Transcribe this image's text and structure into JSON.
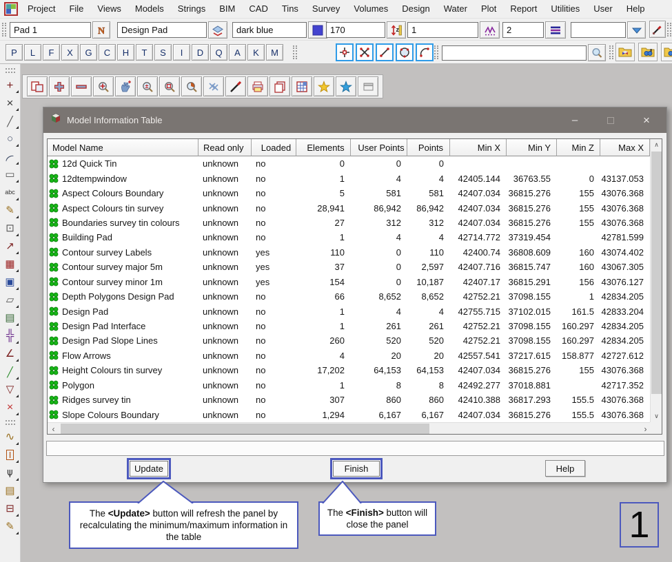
{
  "icons": {
    "scroll_up": "∧",
    "scroll_down": "∨",
    "scroll_left": "‹",
    "scroll_right": "›",
    "minimize": "–",
    "close": "×"
  },
  "menu": {
    "items": [
      "Project",
      "File",
      "Views",
      "Models",
      "Strings",
      "BIM",
      "CAD",
      "Tins",
      "Survey",
      "Volumes",
      "Design",
      "Water",
      "Plot",
      "Report",
      "Utilities",
      "User",
      "Help"
    ]
  },
  "toolbar1": {
    "fields": [
      {
        "name": "cad-text-field",
        "value": "Pad 1",
        "icon": "n-icon"
      },
      {
        "name": "model-field",
        "value": "Design Pad",
        "icon": "layers-icon"
      },
      {
        "name": "colour-field",
        "value": "dark blue",
        "icon": "swatch-icon"
      },
      {
        "name": "height-field",
        "value": "170",
        "icon": "zruler-icon"
      },
      {
        "name": "weight-field",
        "value": "1",
        "icon": "zigzag-icon"
      },
      {
        "name": "linestyle-field",
        "value": "2",
        "icon": "lines-icon"
      },
      {
        "name": "tinable-field",
        "value": "",
        "icon": "dropdown-icon"
      }
    ]
  },
  "toolbar2": {
    "letters": [
      "P",
      "L",
      "F",
      "X",
      "G",
      "C",
      "H",
      "T",
      "S",
      "I",
      "D",
      "Q",
      "A",
      "K",
      "M"
    ],
    "snaps": [
      {
        "name": "snap-point",
        "icon": "snap-point"
      },
      {
        "name": "snap-cross",
        "icon": "snap-cross"
      },
      {
        "name": "snap-line",
        "icon": "snap-line"
      },
      {
        "name": "snap-circle",
        "icon": "snap-circle"
      },
      {
        "name": "snap-arc",
        "icon": "snap-arc"
      }
    ],
    "search_value": "",
    "folders": [
      {
        "name": "models-folder-button",
        "icon": "folder-cube"
      },
      {
        "name": "settings-folder-button",
        "icon": "folder-gears"
      },
      {
        "name": "extra-folder-button",
        "icon": "folder-plain"
      }
    ]
  },
  "floatbar": {
    "buttons": [
      {
        "name": "tile-views-button",
        "icon": "ft-panel"
      },
      {
        "name": "add-view-button",
        "icon": "ft-plus"
      },
      {
        "name": "remove-view-button",
        "icon": "ft-minus"
      },
      {
        "name": "zoom-extents-button",
        "icon": "ft-zoomext"
      },
      {
        "name": "pan-button",
        "icon": "ft-pan"
      },
      {
        "name": "zoom-inout-button",
        "icon": "ft-zoompm"
      },
      {
        "name": "zoom-fit-button",
        "icon": "ft-zoomfit"
      },
      {
        "name": "zoom-previous-button",
        "icon": "ft-zoomprev"
      },
      {
        "name": "no-regen-button",
        "icon": "ft-noregen"
      },
      {
        "name": "regen-brush-button",
        "icon": "ft-brush"
      },
      {
        "name": "plot-button",
        "icon": "ft-print"
      },
      {
        "name": "copy-view-button",
        "icon": "ft-copy"
      },
      {
        "name": "sheet-grid-button",
        "icon": "ft-grid"
      },
      {
        "name": "favourite-yellow-button",
        "icon": "ft-star-y"
      },
      {
        "name": "favourite-blue-button",
        "icon": "ft-star-b"
      },
      {
        "name": "panel-extra-button",
        "icon": "ft-panel2"
      }
    ]
  },
  "sidebar": {
    "tools": [
      {
        "type": "grip"
      },
      {
        "name": "create-point-tool",
        "glyph": "+",
        "color": "#7a1f1f",
        "size": 17
      },
      {
        "name": "junction-cross-tool",
        "glyph": "×",
        "color": "#3a3a3a",
        "size": 17
      },
      {
        "name": "create-line-tool",
        "glyph": "╱",
        "color": "#555",
        "size": 14
      },
      {
        "name": "create-circle-tool",
        "glyph": "○",
        "color": "#44506a",
        "size": 15
      },
      {
        "name": "create-arc-tool",
        "glyph": "(",
        "color": "#44506a",
        "size": 14,
        "rot": 55
      },
      {
        "name": "create-rectangle-tool",
        "glyph": "▭",
        "color": "#555",
        "size": 15
      },
      {
        "name": "create-text-tool",
        "glyph": "abc",
        "color": "#333",
        "size": 9
      },
      {
        "name": "edit-pencil-tool",
        "glyph": "✎",
        "color": "#9a7020",
        "size": 15
      },
      {
        "name": "point-symbol-tool",
        "glyph": "⊡",
        "color": "#555",
        "size": 15
      },
      {
        "name": "measure-tool",
        "glyph": "↗",
        "color": "#7a1f1f",
        "size": 15
      },
      {
        "name": "grid-tool",
        "glyph": "▦",
        "color": "#9a2020",
        "size": 15
      },
      {
        "name": "view-windows-tool",
        "glyph": "▣",
        "color": "#2a4a9a",
        "size": 15
      },
      {
        "name": "clip-polygon-tool",
        "glyph": "▱",
        "color": "#555",
        "size": 15
      },
      {
        "name": "image-tool",
        "glyph": "▤",
        "color": "#3a6a3a",
        "size": 15
      },
      {
        "name": "translate-tool",
        "glyph": "╬",
        "color": "#6a2a8a",
        "size": 16
      },
      {
        "name": "angle-tool",
        "glyph": "∠",
        "color": "#7a1f1f",
        "size": 15
      },
      {
        "name": "segment-colours-tool",
        "glyph": "╱",
        "color": "#2a8a2a",
        "size": 14
      },
      {
        "name": "polygon-tool",
        "glyph": "▽",
        "color": "#7a1f1f",
        "size": 15
      },
      {
        "name": "delete-points-tool",
        "glyph": "×",
        "color": "#c03030",
        "size": 16
      },
      {
        "type": "grip"
      },
      {
        "name": "freehand-draw-tool",
        "glyph": "∿",
        "color": "#9a7020",
        "size": 16
      },
      {
        "name": "interface-tool",
        "glyph": "I",
        "color": "#b05010",
        "size": 13,
        "boxed": true
      },
      {
        "name": "survey-instrument-tool",
        "glyph": "⋔",
        "color": "#333",
        "size": 15,
        "rot": 180
      },
      {
        "name": "edit-notes-tool",
        "glyph": "▤",
        "color": "#9a7020",
        "size": 15
      },
      {
        "name": "section-tool",
        "glyph": "⊟",
        "color": "#7a1f1f",
        "size": 15
      },
      {
        "name": "sketch-tool",
        "glyph": "✎",
        "color": "#9a7020",
        "size": 15
      }
    ]
  },
  "dialog": {
    "title": "Model Information Table",
    "table": {
      "columns": [
        {
          "key": "name",
          "label": "Model Name"
        },
        {
          "key": "read_only",
          "label": "Read only"
        },
        {
          "key": "loaded",
          "label": "Loaded"
        },
        {
          "key": "elements",
          "label": "Elements"
        },
        {
          "key": "user_points",
          "label": "User Points"
        },
        {
          "key": "points",
          "label": "Points"
        },
        {
          "key": "min_x",
          "label": "Min X"
        },
        {
          "key": "min_y",
          "label": "Min Y"
        },
        {
          "key": "min_z",
          "label": "Min Z"
        },
        {
          "key": "max_x",
          "label": "Max X"
        }
      ],
      "rows": [
        {
          "name": "12d Quick Tin",
          "read_only": "unknown",
          "loaded": "no",
          "elements": "0",
          "user_points": "0",
          "points": "0",
          "min_x": "",
          "min_y": "",
          "min_z": "",
          "max_x": ""
        },
        {
          "name": "12dtempwindow",
          "read_only": "unknown",
          "loaded": "no",
          "elements": "1",
          "user_points": "4",
          "points": "4",
          "min_x": "42405.144",
          "min_y": "36763.55",
          "min_z": "0",
          "max_x": "43137.053"
        },
        {
          "name": "Aspect Colours Boundary",
          "read_only": "unknown",
          "loaded": "no",
          "elements": "5",
          "user_points": "581",
          "points": "581",
          "min_x": "42407.034",
          "min_y": "36815.276",
          "min_z": "155",
          "max_x": "43076.368"
        },
        {
          "name": "Aspect Colours tin survey",
          "read_only": "unknown",
          "loaded": "no",
          "elements": "28,941",
          "user_points": "86,942",
          "points": "86,942",
          "min_x": "42407.034",
          "min_y": "36815.276",
          "min_z": "155",
          "max_x": "43076.368"
        },
        {
          "name": "Boundaries survey tin colours",
          "read_only": "unknown",
          "loaded": "no",
          "elements": "27",
          "user_points": "312",
          "points": "312",
          "min_x": "42407.034",
          "min_y": "36815.276",
          "min_z": "155",
          "max_x": "43076.368"
        },
        {
          "name": "Building Pad",
          "read_only": "unknown",
          "loaded": "no",
          "elements": "1",
          "user_points": "4",
          "points": "4",
          "min_x": "42714.772",
          "min_y": "37319.454",
          "min_z": "",
          "max_x": "42781.599"
        },
        {
          "name": "Contour survey Labels",
          "read_only": "unknown",
          "loaded": "yes",
          "elements": "110",
          "user_points": "0",
          "points": "110",
          "min_x": "42400.74",
          "min_y": "36808.609",
          "min_z": "160",
          "max_x": "43074.402"
        },
        {
          "name": "Contour survey major 5m",
          "read_only": "unknown",
          "loaded": "yes",
          "elements": "37",
          "user_points": "0",
          "points": "2,597",
          "min_x": "42407.716",
          "min_y": "36815.747",
          "min_z": "160",
          "max_x": "43067.305"
        },
        {
          "name": "Contour survey minor 1m",
          "read_only": "unknown",
          "loaded": "yes",
          "elements": "154",
          "user_points": "0",
          "points": "10,187",
          "min_x": "42407.17",
          "min_y": "36815.291",
          "min_z": "156",
          "max_x": "43076.127"
        },
        {
          "name": "Depth Polygons Design Pad",
          "read_only": "unknown",
          "loaded": "no",
          "elements": "66",
          "user_points": "8,652",
          "points": "8,652",
          "min_x": "42752.21",
          "min_y": "37098.155",
          "min_z": "1",
          "max_x": "42834.205"
        },
        {
          "name": "Design Pad",
          "read_only": "unknown",
          "loaded": "no",
          "elements": "1",
          "user_points": "4",
          "points": "4",
          "min_x": "42755.715",
          "min_y": "37102.015",
          "min_z": "161.5",
          "max_x": "42833.204"
        },
        {
          "name": "Design Pad Interface",
          "read_only": "unknown",
          "loaded": "no",
          "elements": "1",
          "user_points": "261",
          "points": "261",
          "min_x": "42752.21",
          "min_y": "37098.155",
          "min_z": "160.297",
          "max_x": "42834.205"
        },
        {
          "name": "Design Pad Slope Lines",
          "read_only": "unknown",
          "loaded": "no",
          "elements": "260",
          "user_points": "520",
          "points": "520",
          "min_x": "42752.21",
          "min_y": "37098.155",
          "min_z": "160.297",
          "max_x": "42834.205"
        },
        {
          "name": "Flow Arrows",
          "read_only": "unknown",
          "loaded": "no",
          "elements": "4",
          "user_points": "20",
          "points": "20",
          "min_x": "42557.541",
          "min_y": "37217.615",
          "min_z": "158.877",
          "max_x": "42727.612"
        },
        {
          "name": "Height Colours tin survey",
          "read_only": "unknown",
          "loaded": "no",
          "elements": "17,202",
          "user_points": "64,153",
          "points": "64,153",
          "min_x": "42407.034",
          "min_y": "36815.276",
          "min_z": "155",
          "max_x": "43076.368"
        },
        {
          "name": "Polygon",
          "read_only": "unknown",
          "loaded": "no",
          "elements": "1",
          "user_points": "8",
          "points": "8",
          "min_x": "42492.277",
          "min_y": "37018.881",
          "min_z": "",
          "max_x": "42717.352"
        },
        {
          "name": "Ridges survey tin",
          "read_only": "unknown",
          "loaded": "no",
          "elements": "307",
          "user_points": "860",
          "points": "860",
          "min_x": "42410.388",
          "min_y": "36817.293",
          "min_z": "155.5",
          "max_x": "43076.368"
        },
        {
          "name": "Slope Colours Boundary",
          "read_only": "unknown",
          "loaded": "no",
          "elements": "1,294",
          "user_points": "6,167",
          "points": "6,167",
          "min_x": "42407.034",
          "min_y": "36815.276",
          "min_z": "155.5",
          "max_x": "43076.368"
        }
      ]
    },
    "buttons": {
      "update": "Update",
      "finish": "Finish",
      "help": "Help"
    }
  },
  "callouts": {
    "update": {
      "pre": "The ",
      "bold": "<Update>",
      "post": " button will refresh the panel by recalculating the minimum/maximum information in the table"
    },
    "finish": {
      "pre": "The ",
      "bold": "<Finish>",
      "post": " button will close the panel"
    }
  },
  "page_number": "1"
}
